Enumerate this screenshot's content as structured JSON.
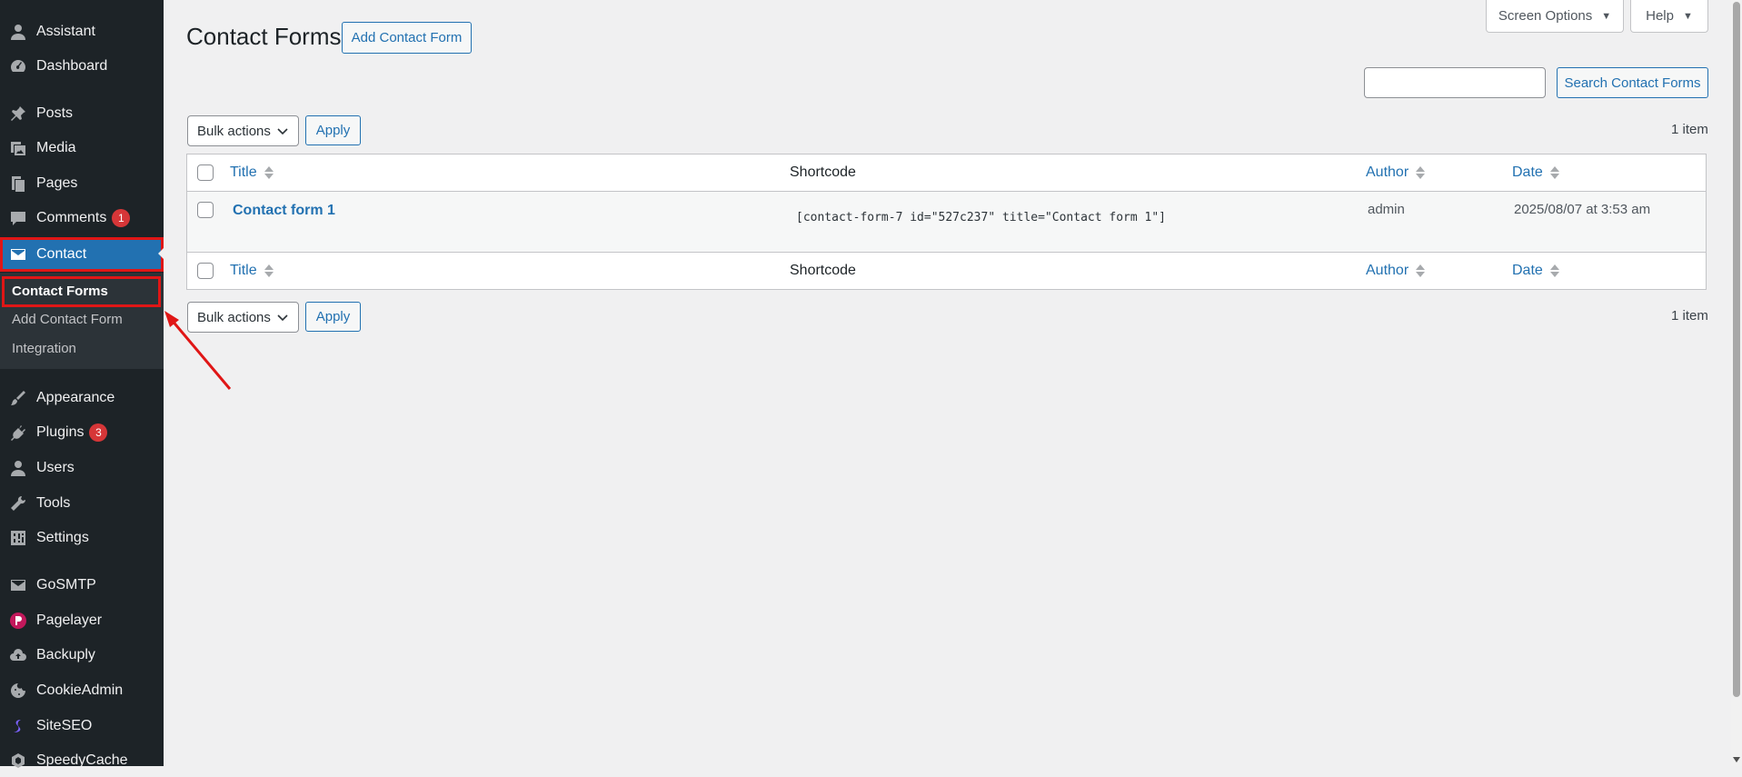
{
  "sidebar": {
    "items": [
      {
        "label": "Assistant",
        "icon": "user-icon"
      },
      {
        "label": "Dashboard",
        "icon": "dashboard-icon"
      },
      {
        "label": "Posts",
        "icon": "pin-icon"
      },
      {
        "label": "Media",
        "icon": "media-icon"
      },
      {
        "label": "Pages",
        "icon": "pages-icon"
      },
      {
        "label": "Comments",
        "icon": "comments-icon",
        "badge": "1"
      },
      {
        "label": "Contact",
        "icon": "envelope-icon"
      },
      {
        "label": "Appearance",
        "icon": "brush-icon"
      },
      {
        "label": "Plugins",
        "icon": "plug-icon",
        "badge": "3"
      },
      {
        "label": "Users",
        "icon": "users-icon"
      },
      {
        "label": "Tools",
        "icon": "wrench-icon"
      },
      {
        "label": "Settings",
        "icon": "settings-icon"
      },
      {
        "label": "GoSMTP",
        "icon": "mail-icon"
      },
      {
        "label": "Pagelayer",
        "icon": "pagelayer-icon"
      },
      {
        "label": "Backuply",
        "icon": "cloud-upload-icon"
      },
      {
        "label": "CookieAdmin",
        "icon": "cookie-icon"
      },
      {
        "label": "SiteSEO",
        "icon": "siteseo-icon"
      },
      {
        "label": "SpeedyCache",
        "icon": "speedycache-icon"
      }
    ],
    "submenu": [
      "Contact Forms",
      "Add Contact Form",
      "Integration"
    ]
  },
  "header": {
    "screen_options": "Screen Options",
    "help": "Help",
    "page_title": "Contact Forms",
    "add_button": "Add Contact Form",
    "search_button": "Search Contact Forms",
    "search_value": ""
  },
  "bulk": {
    "select_label": "Bulk actions",
    "apply": "Apply",
    "count": "1 item"
  },
  "table": {
    "columns": [
      "Title",
      "Shortcode",
      "Author",
      "Date"
    ],
    "rows": [
      {
        "title": "Contact form 1",
        "shortcode": "[contact-form-7 id=\"527c237\" title=\"Contact form 1\"]",
        "author": "admin",
        "date": "2025/08/07 at 3:53 am"
      }
    ]
  },
  "colors": {
    "sidebar_bg": "#1d2327",
    "accent": "#2271b1",
    "badge": "#d63638",
    "annotation": "#e01616"
  }
}
